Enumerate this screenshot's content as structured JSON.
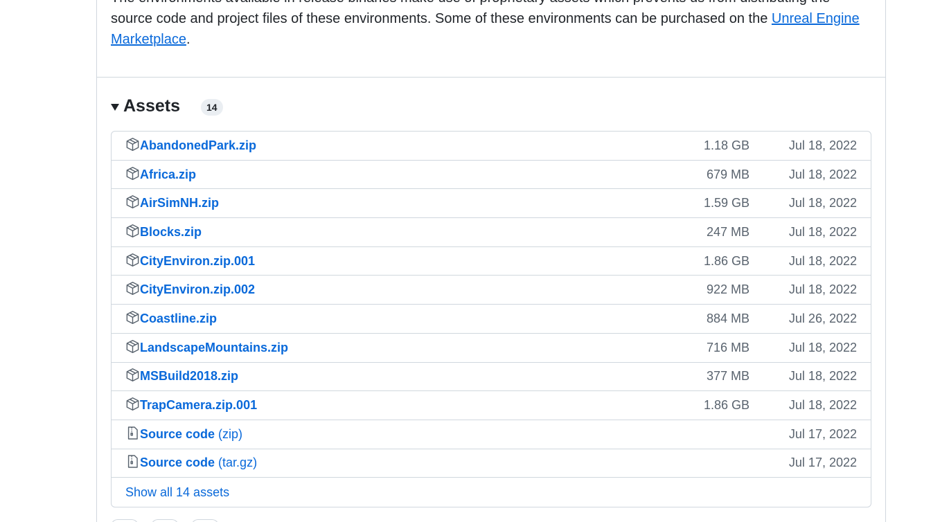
{
  "description": {
    "text_before": "The environments available in release binaries make use of proprietary assets which prevents us from distributing the source code and project files of these environments. Some of these environments can be purchased on the ",
    "link_text": "Unreal Engine Marketplace",
    "text_after": "."
  },
  "assets": {
    "title": "Assets",
    "count": "14",
    "items": [
      {
        "name": "AbandonedPark.zip",
        "size": "1.18 GB",
        "date": "Jul 18, 2022",
        "icon": "package-icon"
      },
      {
        "name": "Africa.zip",
        "size": "679 MB",
        "date": "Jul 18, 2022",
        "icon": "package-icon"
      },
      {
        "name": "AirSimNH.zip",
        "size": "1.59 GB",
        "date": "Jul 18, 2022",
        "icon": "package-icon"
      },
      {
        "name": "Blocks.zip",
        "size": "247 MB",
        "date": "Jul 18, 2022",
        "icon": "package-icon"
      },
      {
        "name": "CityEnviron.zip.001",
        "size": "1.86 GB",
        "date": "Jul 18, 2022",
        "icon": "package-icon"
      },
      {
        "name": "CityEnviron.zip.002",
        "size": "922 MB",
        "date": "Jul 18, 2022",
        "icon": "package-icon"
      },
      {
        "name": "Coastline.zip",
        "size": "884 MB",
        "date": "Jul 26, 2022",
        "icon": "package-icon"
      },
      {
        "name": "LandscapeMountains.zip",
        "size": "716 MB",
        "date": "Jul 18, 2022",
        "icon": "package-icon"
      },
      {
        "name": "MSBuild2018.zip",
        "size": "377 MB",
        "date": "Jul 18, 2022",
        "icon": "package-icon"
      },
      {
        "name": "TrapCamera.zip.001",
        "size": "1.86 GB",
        "date": "Jul 18, 2022",
        "icon": "package-icon"
      }
    ],
    "source_items": [
      {
        "name": "Source code",
        "suffix": "(zip)",
        "date": "Jul 17, 2022",
        "icon": "file-zip-icon"
      },
      {
        "name": "Source code",
        "suffix": "(tar.gz)",
        "date": "Jul 17, 2022",
        "icon": "file-zip-icon"
      }
    ],
    "show_all": "Show all 14 assets"
  },
  "colors": {
    "link": "#0969da",
    "border": "#d0d7de",
    "muted": "#59636e"
  }
}
